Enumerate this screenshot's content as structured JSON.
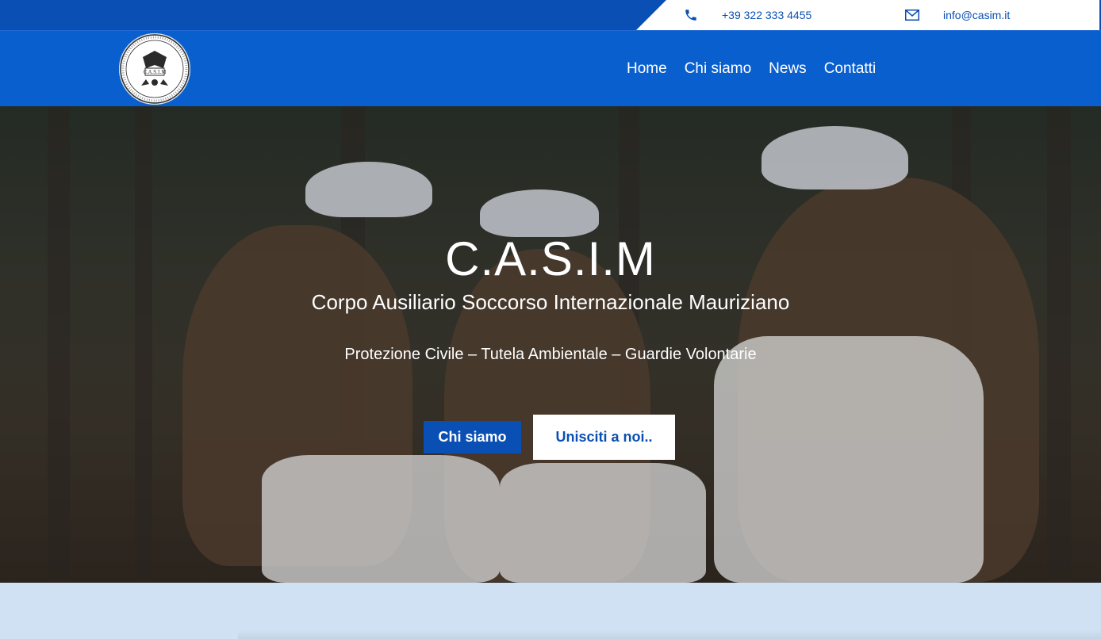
{
  "topbar": {
    "phone": "+39 322 333 4455",
    "email": "info@casim.it",
    "icons": {
      "phone": "phone-icon",
      "email": "envelope-icon"
    }
  },
  "header": {
    "logo_text": "C.A.S.I.M",
    "nav": [
      {
        "label": "Home"
      },
      {
        "label": "Chi siamo"
      },
      {
        "label": "News"
      },
      {
        "label": "Contatti"
      }
    ]
  },
  "hero": {
    "title": "C.A.S.I.M",
    "subtitle": "Corpo Ausiliario Soccorso Internazionale Mauriziano",
    "tagline": "Protezione Civile – Tutela Ambientale – Guardie Volontarie",
    "primary_button": "Chi siamo",
    "secondary_button": "Unisciti a noi.."
  },
  "colors": {
    "primary": "#0a4fb3",
    "header": "#0a5fcf",
    "lower_band": "#cfe1f2"
  }
}
